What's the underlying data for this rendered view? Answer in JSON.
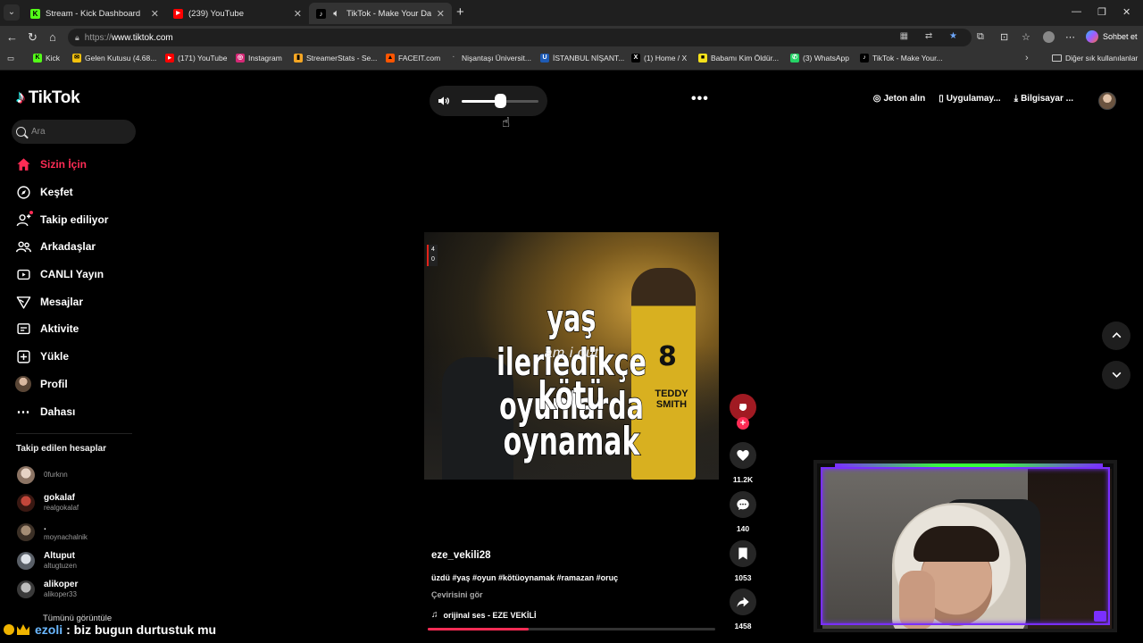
{
  "browser": {
    "tabs": [
      {
        "title": "Stream - Kick Dashboard",
        "icon": "kick-icon",
        "color": "#53fc18",
        "glyph": "K"
      },
      {
        "title": "(239) YouTube",
        "icon": "youtube-icon",
        "color": "#ff0000",
        "glyph": "▶"
      },
      {
        "title": "TikTok - Make Your Day",
        "icon": "tiktok-icon",
        "color": "#000000",
        "glyph": "♪",
        "active": true
      }
    ],
    "url_protocol": "https://",
    "url_host": "www.tiktok.com",
    "copilot_label": "Sohbet et",
    "bookmarks": [
      {
        "label": "Kick",
        "color": "#53fc18",
        "glyph": "K"
      },
      {
        "label": "Gelen Kutusu (4.68...",
        "color": "#f4c20d",
        "glyph": "✉"
      },
      {
        "label": "(171) YouTube",
        "color": "#ff0000",
        "glyph": "▶"
      },
      {
        "label": "Instagram",
        "color": "#d62976",
        "glyph": "◎"
      },
      {
        "label": "StreamerStats - Se...",
        "color": "#f5a623",
        "glyph": "▮"
      },
      {
        "label": "FACEIT.com",
        "color": "#ff5500",
        "glyph": "▲"
      },
      {
        "label": "Nişantaşı Üniversit...",
        "color": "#333333",
        "glyph": "·"
      },
      {
        "label": "İSTANBUL NİŞANT...",
        "color": "#1e5bb5",
        "glyph": "U"
      },
      {
        "label": "(1) Home / X",
        "color": "#000000",
        "glyph": "X"
      },
      {
        "label": "Babamı Kim Öldür...",
        "color": "#f5e11b",
        "glyph": "■"
      },
      {
        "label": "(3) WhatsApp",
        "color": "#25d366",
        "glyph": "✆"
      },
      {
        "label": "TikTok - Make Your...",
        "color": "#000000",
        "glyph": "♪"
      }
    ],
    "other_bookmarks": "Diğer sık kullanılanlar"
  },
  "tiktok": {
    "logo_text": "TikTok",
    "search_placeholder": "Ara",
    "nav": [
      {
        "label": "Sizin İçin",
        "icon": "home-icon",
        "glyph": "⌂",
        "active": true
      },
      {
        "label": "Keşfet",
        "icon": "compass-icon",
        "glyph": "⊘"
      },
      {
        "label": "Takip ediliyor",
        "icon": "following-icon",
        "glyph": "⚇",
        "dot": true
      },
      {
        "label": "Arkadaşlar",
        "icon": "friends-icon",
        "glyph": "⚇"
      },
      {
        "label": "CANLI Yayın",
        "icon": "live-icon",
        "glyph": "▢"
      },
      {
        "label": "Mesajlar",
        "icon": "messages-icon",
        "glyph": "▽"
      },
      {
        "label": "Aktivite",
        "icon": "activity-icon",
        "glyph": "▭"
      },
      {
        "label": "Yükle",
        "icon": "upload-icon",
        "glyph": "⊞"
      },
      {
        "label": "Profil",
        "icon": "profile-avatar-icon",
        "glyph": ""
      },
      {
        "label": "Dahası",
        "icon": "more-icon",
        "glyph": "⋯"
      }
    ],
    "following_header": "Takip edilen hesaplar",
    "following": [
      {
        "name": "",
        "handle": "0furknn",
        "color": "#b8a090"
      },
      {
        "name": "gokalaf",
        "handle": "realgokalaf",
        "color": "#8a2a20"
      },
      {
        "name": ".",
        "handle": "moynachalnik",
        "color": "#6b5a48"
      },
      {
        "name": "Altuput",
        "handle": "altugtuzen",
        "color": "#9aa0a8"
      },
      {
        "name": "alikoper",
        "handle": "alikoper33",
        "color": "#555555"
      }
    ],
    "see_all": "Tümünü görüntüle",
    "top_actions": {
      "coins": "Jeton alın",
      "app": "Uygulamay...",
      "desktop": "Bilgisayar ..."
    },
    "volume_level": 0.5,
    "video": {
      "caption_line1": "yaş ilerledikçe oyunlarda",
      "caption_sub": "am i out",
      "caption_line2": "kötü oynamak",
      "jersey_number": "8",
      "jersey_name": "TEDDY SMITH",
      "score_top": "4",
      "score_bottom": "0"
    },
    "author": "eze_vekili28",
    "description": "üzdü #yaş #oyun #kötüoynamak #ramazan #oruç",
    "translate": "Çevirisini gör",
    "sound": "orijinal ses - EZE VEKİLİ",
    "progress": 0.35,
    "creator_badge": "10",
    "counts": {
      "likes": "11.2K",
      "comments": "140",
      "saves": "1053",
      "shares": "1458"
    }
  },
  "chat": {
    "user": "ezoli",
    "message": ": biz bugun durtustuk mu"
  },
  "colors": {
    "accent": "#fe2c55",
    "cam_border": "#7a2fff",
    "cam_neon": "#37ff3a"
  }
}
